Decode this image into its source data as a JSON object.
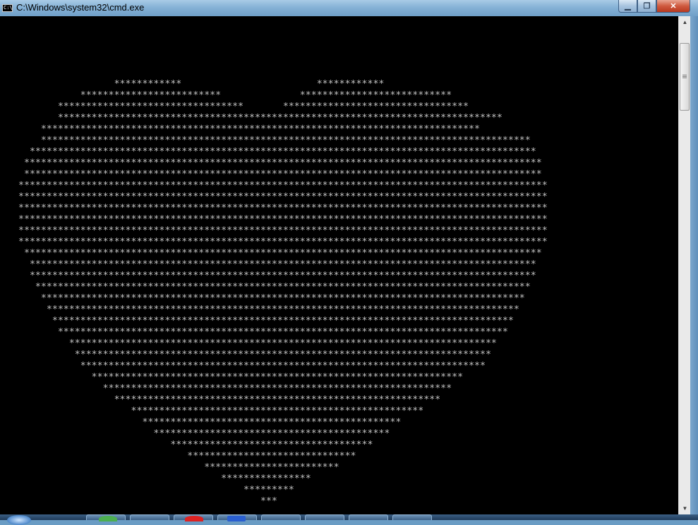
{
  "window": {
    "title": "C:\\Windows\\system32\\cmd.exe",
    "icon_text": "C:\\",
    "controls": {
      "minimize": "▁",
      "maximize": "❐",
      "close": "✕"
    }
  },
  "console": {
    "lines": [
      "                 ************                        ************",
      "           *************************              ***************************",
      "       *********************************       *********************************",
      "       *******************************************************************************",
      "    ******************************************************************************",
      "    ***************************************************************************************",
      "  ******************************************************************************************",
      " ********************************************************************************************",
      " ********************************************************************************************",
      "**********************************************************************************************",
      "**********************************************************************************************",
      "**********************************************************************************************",
      "**********************************************************************************************",
      "**********************************************************************************************",
      "**********************************************************************************************",
      " ********************************************************************************************",
      "  ******************************************************************************************",
      "  ******************************************************************************************",
      "   ****************************************************************************************",
      "    **************************************************************************************",
      "     ************************************************************************************",
      "      **********************************************************************************",
      "       ********************************************************************************",
      "         ****************************************************************************",
      "          **************************************************************************",
      "           ************************************************************************",
      "             ******************************************************************",
      "               **************************************************************",
      "                 **********************************************************",
      "                    ****************************************************",
      "                      **********************************************",
      "                        ******************************************",
      "                           ************************************",
      "                              ******************************",
      "                                 ************************",
      "                                    ****************",
      "                                        *********",
      "                                           ***"
    ]
  },
  "scrollbar": {
    "up_arrow": "▲",
    "down_arrow": "▼",
    "position": 0.05
  },
  "colors": {
    "console_bg": "#000000",
    "console_fg": "#c0c0c0",
    "titlebar": "#86b2d6",
    "close_button": "#cf5a3f"
  }
}
